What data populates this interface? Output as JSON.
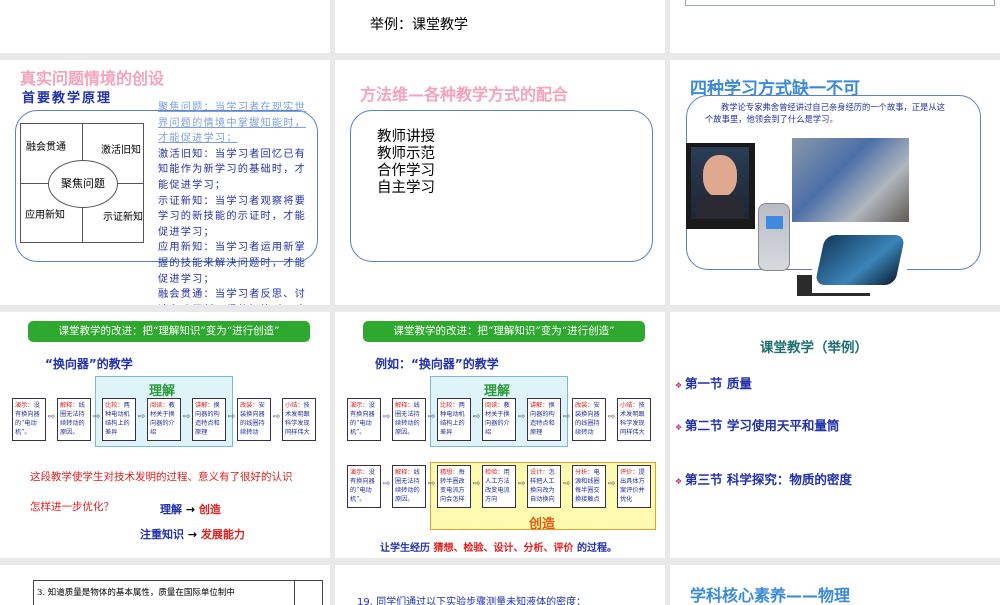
{
  "slides": {
    "s2": {
      "text": "举例：课堂教学"
    },
    "s4": {
      "title": "真实问题情境的创设",
      "subtitle": "首要教学原理",
      "diagram": {
        "tl": "融会贯通",
        "tr": "激活旧知",
        "center": "聚焦问题",
        "bl": "应用新知",
        "br": "示证新知"
      },
      "lines": [
        "聚焦问题：当学习者在现实世界问题的情境中掌握知能时，才能促进学习；",
        "激活旧知：当学习者回忆已有知能作为新学习的基础时，才能促进学习；",
        "示证新知：当学习者观察将要学习的新技能的示证时，才能促进学习；",
        "应用新知：当学习者运用新掌握的技能来解决问题时，才能促进学习；",
        "融会贯通：当学习者反思、讨论和巩固新习得的知能时，才能促进学习。"
      ]
    },
    "s5": {
      "title": "方法维—各种教学方式的配合",
      "items": [
        "教师讲授",
        "教师示范",
        "合作学习",
        "自主学习"
      ]
    },
    "s6": {
      "title": "四种学习方式缺一不可",
      "para": "教学论专家弗舍曾经讲过自己亲身经历的一个故事，正是从这个故事里，他领会到了什么是学习。"
    },
    "s7": {
      "banner": "课堂教学的改进：把“理解知识”变为“进行创造”",
      "heading": "“换向器”的教学",
      "group_label": "理解",
      "note": "这段教学使学生对技术发明的过程、意义有了很好的认识",
      "question": "怎样进一步优化？",
      "arrow1": {
        "from": "理解",
        "arrow": "→",
        "to": "创造"
      },
      "arrow2": {
        "from": "注重知识",
        "arrow": "→",
        "to": "发展能力"
      }
    },
    "s8": {
      "banner": "课堂教学的改进：把“理解知识”变为“进行创造”",
      "heading": "例如：“换向器”的教学",
      "group1_label": "理解",
      "group2_label": "创造",
      "footer_pre": "让学生经历",
      "footer_mid": "猜想、检验、设计、分析、评价",
      "footer_post": "的过程。"
    },
    "s9": {
      "title": "课堂教学（举例）",
      "bullets": [
        "第一节  质量",
        "第二节  学习使用天平和量筒",
        "第三节  科学探究：物质的密度"
      ]
    },
    "s10": {
      "text": "3. 知道质量是物体的基本属性，质量在国际单位制中"
    },
    "s11": {
      "text": "19. 同学们通过以下实验步骤测量未知液体的密度："
    },
    "s12": {
      "title": "学科核心素养——物理"
    }
  },
  "flow_row1": [
    [
      "演示：",
      "没有换向器的“电动机”。"
    ],
    [
      "解释：",
      "线圈无法持续转动的原因。"
    ],
    [
      "比较：",
      "两种电动机结构上的差异"
    ],
    [
      "阅读：",
      "教材关于换向器的介绍"
    ],
    [
      "讲解：",
      "换向器的构造特点和原理"
    ],
    [
      "改装：",
      "安装换向器的线圈持续转动"
    ],
    [
      "小结：",
      "技术发明跟科学发现同样伟大"
    ]
  ],
  "flow_row2": [
    [
      "演示：",
      "没有换向器的“电动机”。"
    ],
    [
      "解释：",
      "线圈无法持续转动的原因。"
    ],
    [
      "猜想：",
      "每转半圈改变电流方向会怎样"
    ],
    [
      "检验：",
      "用人工方法改变电流方向"
    ],
    [
      "设计：",
      "怎样把人工换向改为自动换向"
    ],
    [
      "分析：",
      "电源和线圈每半圈交换接触点"
    ],
    [
      "评价：",
      "提出具体方案评价并优化"
    ]
  ],
  "colors": {
    "pink": "#f4a3bb",
    "blue": "#2232a8",
    "green": "#2fa82f",
    "title_blue": "#3a8ad8"
  }
}
